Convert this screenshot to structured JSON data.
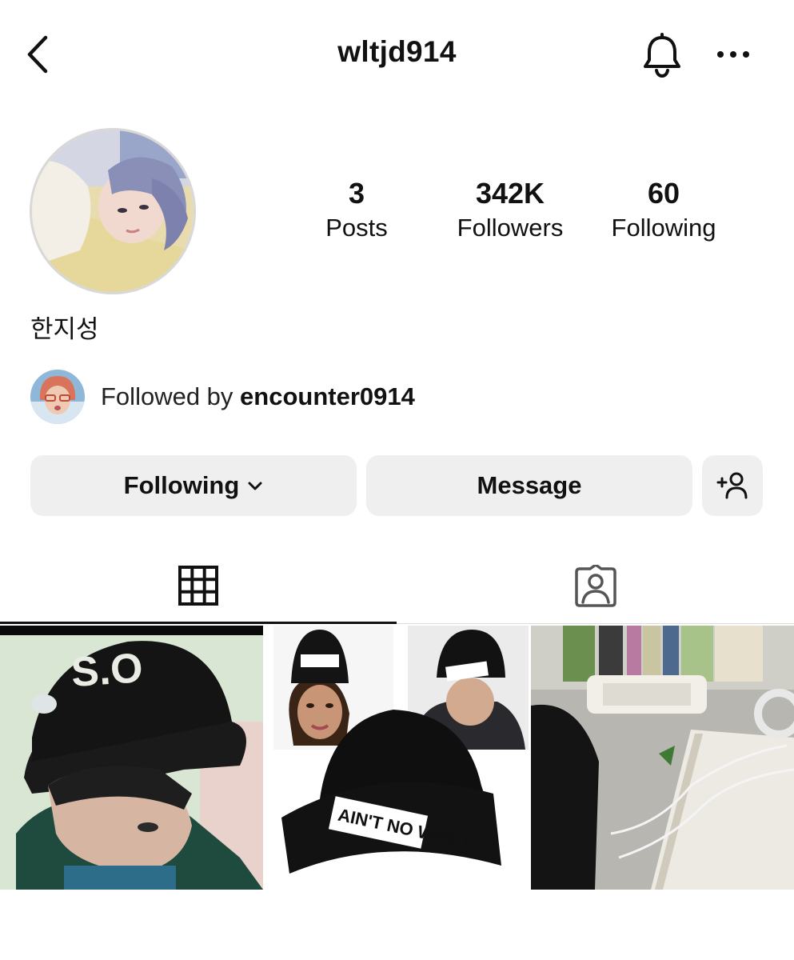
{
  "header": {
    "username": "wltjd914",
    "back_icon": "chevron-left-icon",
    "bell_icon": "bell-icon",
    "more_icon": "more-horizontal-icon"
  },
  "profile": {
    "display_name": "한지성",
    "stats": {
      "posts": {
        "value": "3",
        "label": "Posts"
      },
      "followers": {
        "value": "342K",
        "label": "Followers"
      },
      "following": {
        "value": "60",
        "label": "Following"
      }
    },
    "followed_by": {
      "prefix": "Followed by ",
      "user": "encounter0914"
    }
  },
  "actions": {
    "following_label": "Following",
    "message_label": "Message",
    "add_user_icon": "add-person-icon"
  },
  "tabs": [
    {
      "icon": "grid-icon",
      "active": true
    },
    {
      "icon": "tagged-person-icon",
      "active": false
    }
  ],
  "posts": [
    {
      "cap_text": "S.O"
    },
    {
      "hat_text": "AIN'T NO WIFEY"
    },
    {
      "description": "desk photo"
    }
  ],
  "colors": {
    "button_bg": "#efefef",
    "text": "#111111",
    "divider": "#dbdbdb"
  }
}
